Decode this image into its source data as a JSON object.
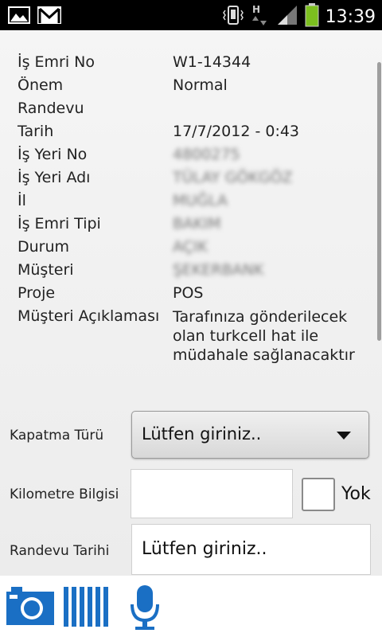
{
  "status_bar": {
    "time": "13:39",
    "left_icons": [
      "gallery-icon",
      "gmail-icon"
    ],
    "right_icons": [
      "vibrate-icon",
      "data-hplus-icon",
      "signal-icon",
      "battery-icon"
    ]
  },
  "details": [
    {
      "label": "İş Emri No",
      "value": "W1-14344",
      "blurred": false
    },
    {
      "label": "Önem",
      "value": "Normal",
      "blurred": false
    },
    {
      "label": "Randevu",
      "value": "",
      "blurred": false
    },
    {
      "label": "Tarih",
      "value": "17/7/2012 - 0:43",
      "blurred": false
    },
    {
      "label": "İş Yeri No",
      "value": "4800275",
      "blurred": true
    },
    {
      "label": "İş Yeri Adı",
      "value": "TÜLAY GÖKGÖZ",
      "blurred": true
    },
    {
      "label": "İl",
      "value": "MUĞLA",
      "blurred": true
    },
    {
      "label": "İş Emri Tipi",
      "value": "BAKIM",
      "blurred": true
    },
    {
      "label": "Durum",
      "value": "AÇIK",
      "blurred": true
    },
    {
      "label": "Müşteri",
      "value": "ŞEKERBANK",
      "blurred": true
    },
    {
      "label": "Proje",
      "value": "POS",
      "blurred": false
    },
    {
      "label": "Müşteri Açıklaması",
      "value": "Tarafınıza gönderilecek olan turkcell hat ile müdahale sağlanacaktır",
      "blurred": false
    }
  ],
  "form": {
    "kapatma_label": "Kapatma Türü",
    "kapatma_value": "Lütfen giriniz..",
    "km_label": "Kilometre Bilgisi",
    "km_value": "",
    "yok_label": "Yok",
    "yok_checked": false,
    "randevu_tarihi_label": "Randevu Tarihi",
    "randevu_tarihi_value": "Lütfen giriniz.."
  },
  "toolbar": {
    "icons": [
      "camera-icon",
      "barcode-icon",
      "microphone-icon"
    ],
    "accent_color": "#1a6fc4"
  }
}
